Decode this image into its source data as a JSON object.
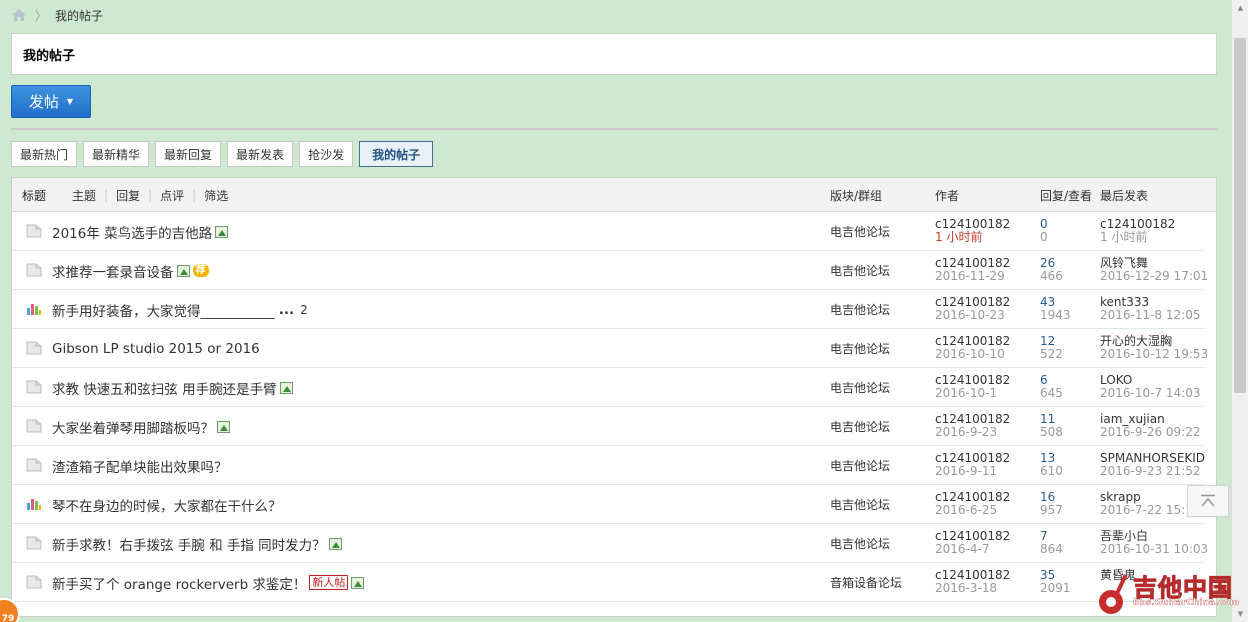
{
  "breadcrumb": {
    "current": "我的帖子"
  },
  "page_title": "我的帖子",
  "post_button": {
    "label": "发帖"
  },
  "tabs": [
    {
      "label": "最新热门",
      "active": false
    },
    {
      "label": "最新精华",
      "active": false
    },
    {
      "label": "最新回复",
      "active": false
    },
    {
      "label": "最新发表",
      "active": false
    },
    {
      "label": "抢沙发",
      "active": false
    },
    {
      "label": "我的帖子",
      "active": true
    }
  ],
  "table_header": {
    "title": "标题",
    "filters": [
      "主题",
      "回复",
      "点评",
      "筛选"
    ],
    "forum": "版块/群组",
    "author": "作者",
    "stats": "回复/查看",
    "last_post": "最后发表"
  },
  "rows": [
    {
      "icon": "folder-icon",
      "subject": "2016年 菜鸟选手的吉他路",
      "image": true,
      "forum": "电吉他论坛",
      "author": "c124100182",
      "date": "1 小时前",
      "date_new": true,
      "replies": "0",
      "views": "0",
      "last_user": "c124100182",
      "last_time": "1 小时前"
    },
    {
      "icon": "folder-icon",
      "subject": "求推荐一套录音设备",
      "image": true,
      "badge_rec": "荐",
      "forum": "电吉他论坛",
      "author": "c124100182",
      "date": "2016-11-29",
      "replies": "26",
      "views": "466",
      "last_user": "风铃飞舞",
      "last_time": "2016-12-29 17:01"
    },
    {
      "icon": "poll-icon",
      "subject": "新手用好装备，大家觉得___________",
      "ellipsis": "...",
      "page": "2",
      "forum": "电吉他论坛",
      "author": "c124100182",
      "date": "2016-10-23",
      "replies": "43",
      "views": "1943",
      "last_user": "kent333",
      "last_time": "2016-11-8 12:05"
    },
    {
      "icon": "folder-icon",
      "subject": "Gibson LP studio 2015 or 2016",
      "forum": "电吉他论坛",
      "author": "c124100182",
      "date": "2016-10-10",
      "replies": "12",
      "views": "522",
      "last_user": "开心的大湿胸",
      "last_time": "2016-10-12 19:53"
    },
    {
      "icon": "folder-icon",
      "subject": "求教 快速五和弦扫弦 用手腕还是手臂",
      "image": true,
      "forum": "电吉他论坛",
      "author": "c124100182",
      "date": "2016-10-1",
      "replies": "6",
      "views": "645",
      "last_user": "LOKO",
      "last_time": "2016-10-7 14:03"
    },
    {
      "icon": "folder-icon",
      "subject": "大家坐着弹琴用脚踏板吗？",
      "image": true,
      "forum": "电吉他论坛",
      "author": "c124100182",
      "date": "2016-9-23",
      "replies": "11",
      "views": "508",
      "last_user": "iam_xujian",
      "last_time": "2016-9-26 09:22"
    },
    {
      "icon": "folder-icon",
      "subject": "渣渣箱子配单块能出效果吗？",
      "forum": "电吉他论坛",
      "author": "c124100182",
      "date": "2016-9-11",
      "replies": "13",
      "views": "610",
      "last_user": "SPMANHORSEKID",
      "last_time": "2016-9-23 21:52"
    },
    {
      "icon": "poll-icon",
      "subject": "琴不在身边的时候，大家都在干什么？",
      "forum": "电吉他论坛",
      "author": "c124100182",
      "date": "2016-6-25",
      "replies": "16",
      "views": "957",
      "last_user": "skrapp",
      "last_time": "2016-7-22 15:14"
    },
    {
      "icon": "folder-icon",
      "subject": "新手求教！右手拨弦 手腕 和 手指 同时发力？",
      "image": true,
      "forum": "电吉他论坛",
      "author": "c124100182",
      "date": "2016-4-7",
      "replies": "7",
      "views": "864",
      "last_user": "吾辈小白",
      "last_time": "2016-10-31 10:03"
    },
    {
      "icon": "folder-icon",
      "subject": "新手买了个 orange rockerverb 求鉴定！",
      "badge_new": "新人帖",
      "image": true,
      "forum": "音箱设备论坛",
      "author": "c124100182",
      "date": "2016-3-18",
      "replies": "35",
      "views": "2091",
      "last_user": "黄昏鬼",
      "last_time": ""
    }
  ],
  "watermark": {
    "text": "吉他中国",
    "url": "bbs.GuitarChina.com"
  },
  "corner_badge": "79",
  "colors": {
    "background": "#cfe8d0",
    "accent": "#1f6fc9",
    "new_date": "#c03b2b",
    "link": "#2b5c91"
  }
}
